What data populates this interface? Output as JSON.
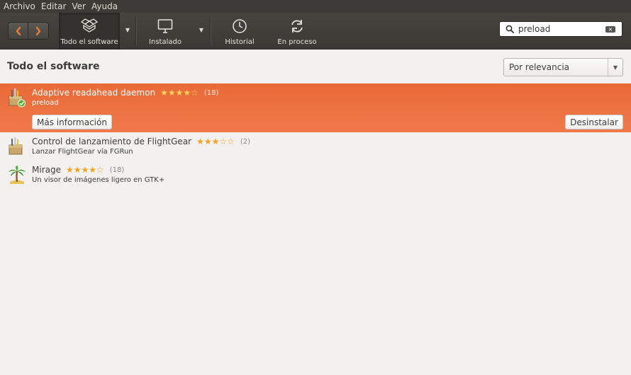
{
  "menu": [
    "Archivo",
    "Editar",
    "Ver",
    "Ayuda"
  ],
  "toolbar": {
    "all_label": "Todo el software",
    "installed_label": "Instalado",
    "history_label": "Historial",
    "progress_label": "En proceso",
    "icons": {
      "back": "chevron-left-icon",
      "forward": "chevron-right-icon",
      "all": "dropbox-package-icon",
      "installed": "monitor-icon",
      "history": "clock-icon",
      "progress": "sync-arrows-icon"
    }
  },
  "search": {
    "value": "preload",
    "icon": "search-icon",
    "clear_icon": "clear-icon"
  },
  "header": {
    "title": "Todo el software"
  },
  "sort": {
    "selected": "Por relevancia"
  },
  "results": [
    {
      "name": "Adaptive readahead daemon",
      "summary": "preload",
      "rating": 4,
      "stars": "★★★★☆",
      "count": "(18)",
      "installed": true,
      "selected": true,
      "icon": "installed-package-icon"
    },
    {
      "name": "Control de lanzamiento de FlightGear",
      "summary": "Lanzar FlightGear vía FGRun",
      "rating": 3,
      "stars": "★★★☆☆",
      "count": "(2)",
      "installed": false,
      "selected": false,
      "icon": "package-icon"
    },
    {
      "name": "Mirage",
      "summary": "Un visor de imágenes ligero en GTK+",
      "rating": 4,
      "stars": "★★★★☆",
      "count": "(18)",
      "installed": false,
      "selected": false,
      "icon": "palm-tree-icon"
    }
  ],
  "buttons": {
    "more_info": "Más información",
    "uninstall": "Desinstalar"
  },
  "colors": {
    "selection": "#e9703f",
    "star": "#f5a21b",
    "toolbar": "#3c3b37"
  }
}
